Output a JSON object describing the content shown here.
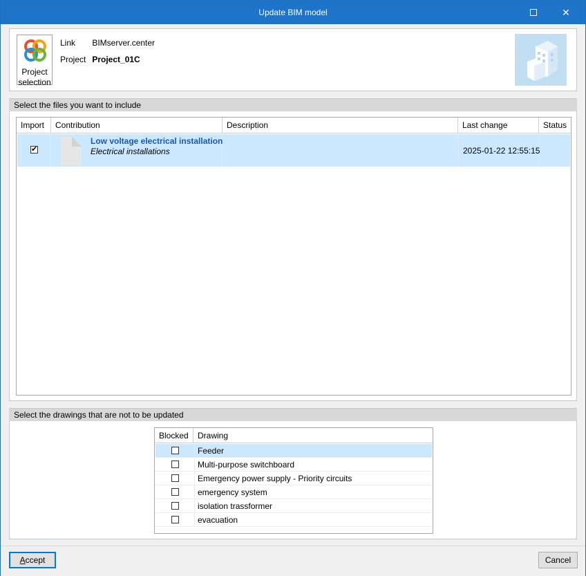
{
  "window": {
    "title": "Update BIM model"
  },
  "header": {
    "project_button": {
      "line1": "Project",
      "line2": "selection"
    },
    "link_label": "Link",
    "link_value": "BIMserver.center",
    "project_label": "Project",
    "project_value": "Project_01C"
  },
  "files_section": {
    "title": "Select the files you want to include",
    "columns": [
      "Import",
      "Contribution",
      "Description",
      "Last change",
      "Status"
    ],
    "rows": [
      {
        "import_checked": true,
        "title": "Low voltage electrical installation",
        "subtitle": "Electrical installations",
        "description": "",
        "last_change": "2025-01-22 12:55:15",
        "status": ""
      }
    ]
  },
  "drawings_section": {
    "title": "Select the drawings that are not to be updated",
    "columns": [
      "Blocked",
      "Drawing"
    ],
    "rows": [
      {
        "blocked": false,
        "name": "Feeder"
      },
      {
        "blocked": false,
        "name": "Multi-purpose switchboard"
      },
      {
        "blocked": false,
        "name": "Emergency power supply - Priority circuits"
      },
      {
        "blocked": false,
        "name": "emergency system"
      },
      {
        "blocked": false,
        "name": "isolation trassformer"
      },
      {
        "blocked": false,
        "name": "evacuation"
      }
    ]
  },
  "footer": {
    "accept_prefix": "A",
    "accept_rest": "ccept",
    "cancel": "Cancel"
  },
  "colors": {
    "titlebar": "#1e74c8",
    "selection": "#cce8ff",
    "link_title": "#1c57a8"
  },
  "icons": [
    "bimserver-logo-icon",
    "building-icon",
    "document-icon",
    "close-icon",
    "maximize-icon"
  ]
}
